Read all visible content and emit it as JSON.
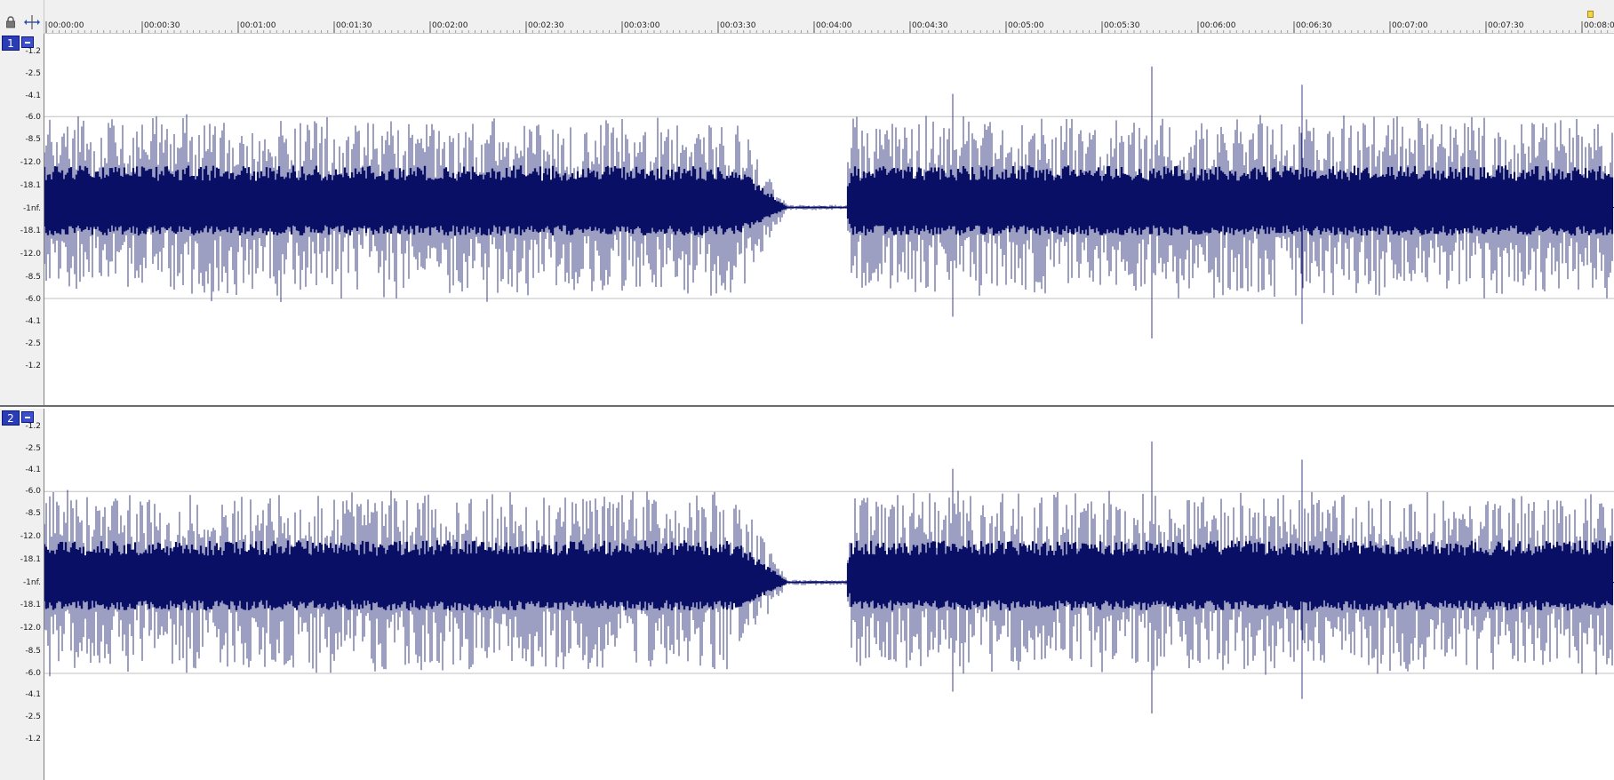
{
  "ruler": {
    "ticks": [
      "00:00:00",
      "00:00:30",
      "00:01:00",
      "00:01:30",
      "00:02:00",
      "00:02:30",
      "00:03:00",
      "00:03:30",
      "00:04:00",
      "00:04:30",
      "00:05:00",
      "00:05:30",
      "00:06:00",
      "00:06:30",
      "00:07:00",
      "00:07:30",
      "00:08:00"
    ]
  },
  "channels": [
    {
      "label": "1",
      "db_scale": [
        "-1.2",
        "-2.5",
        "-4.1",
        "-6.0",
        "-8.5",
        "-12.0",
        "-18.1",
        "-1nf.",
        "-18.1",
        "-12.0",
        "-8.5",
        "-6.0",
        "-4.1",
        "-2.5",
        "-1.2"
      ]
    },
    {
      "label": "2",
      "db_scale": [
        "-1.2",
        "-2.5",
        "-4.1",
        "-6.0",
        "-8.5",
        "-12.0",
        "-18.1",
        "-1nf.",
        "-18.1",
        "-12.0",
        "-8.5",
        "-6.0",
        "-4.1",
        "-2.5",
        "-1.2"
      ]
    }
  ],
  "colors": {
    "waveform": "#0a0f66",
    "waveform_spike": "#3a3f86",
    "grid_line": "#c0c0c0",
    "channel_badge": "#2a3cb6",
    "loop_marker": "#f2d54a"
  },
  "icons": {
    "lock": "lock-icon",
    "snap": "snap-to-grid-icon",
    "channel_toggle": "minus-icon"
  }
}
